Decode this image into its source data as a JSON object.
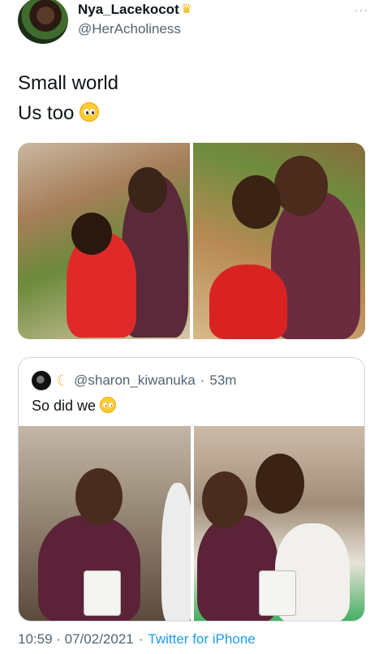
{
  "tweet": {
    "display_name": "Nya_Lacekocot",
    "name_emoji": "crown-icon",
    "handle": "@HerAcholiness",
    "more_label": "···",
    "line1": "Small world",
    "line2": "Us too",
    "line2_emoji": "pleading-face-icon",
    "timestamp": "10:59 · 07/02/2021",
    "dot": "·",
    "source": "Twitter for iPhone"
  },
  "quote": {
    "handle": "@sharon_kiwanuka",
    "dot": "·",
    "time": "53m",
    "text": "So did we",
    "text_emoji": "pleading-face-icon",
    "avatar_emoji": "crescent-moon-icon"
  },
  "colors": {
    "link": "#1d9bf0",
    "secondary_text": "#536471",
    "primary_text": "#0f1419",
    "border": "#cfd9de"
  }
}
